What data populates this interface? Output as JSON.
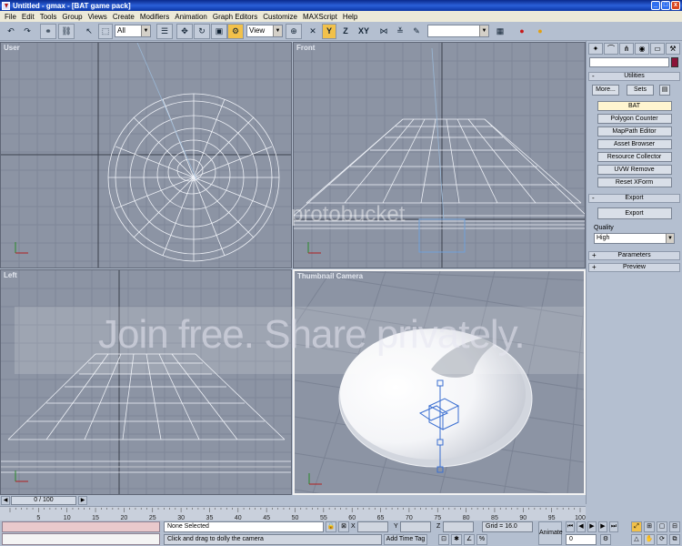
{
  "window": {
    "title": "Untitled - gmax - [BAT game pack]",
    "buttons": [
      "_",
      "□",
      "x"
    ]
  },
  "menu": [
    "File",
    "Edit",
    "Tools",
    "Group",
    "Views",
    "Create",
    "Modifiers",
    "Animation",
    "Graph Editors",
    "Customize",
    "MAXScript",
    "Help"
  ],
  "toolbar": {
    "selection_filter": "All",
    "reference_coord": "View",
    "axis_y": "Y",
    "axis_z": "Z",
    "axis_xy": "XY",
    "named_selection": ""
  },
  "viewports": {
    "top_left": "User",
    "top_right": "Front",
    "bottom_left": "Left",
    "bottom_right": "Thumbnail Camera"
  },
  "watermark": {
    "small": "protobucket",
    "large": "Join free. Share privately."
  },
  "command_panel": {
    "utilities_title": "Utilities",
    "more_label": "More...",
    "sets_label": "Sets",
    "bat_title": "BAT",
    "buttons": [
      "Polygon Counter",
      "MapPath Editor",
      "Asset Browser",
      "Resource Collector",
      "UVW Remove",
      "Reset XForm"
    ],
    "export_title": "Export",
    "export_button": "Export",
    "quality_label": "Quality",
    "quality_value": "High",
    "parameters_title": "Parameters",
    "preview_title": "Preview"
  },
  "timeline": {
    "frame_display": "0 / 100",
    "frame_ticks": [
      "5",
      "10",
      "15",
      "20",
      "25",
      "30",
      "35",
      "40",
      "45",
      "50",
      "55",
      "60",
      "65",
      "70",
      "75",
      "80",
      "85",
      "90",
      "95",
      "100"
    ]
  },
  "status": {
    "selection": "None Selected",
    "prompt": "Click and drag to dolly the camera",
    "x_label": "X",
    "y_label": "Y",
    "z_label": "Z",
    "grid": "Grid = 16.0",
    "add_time_tag": "Add Time Tag",
    "animate": "Animate",
    "frame_value": "0"
  }
}
